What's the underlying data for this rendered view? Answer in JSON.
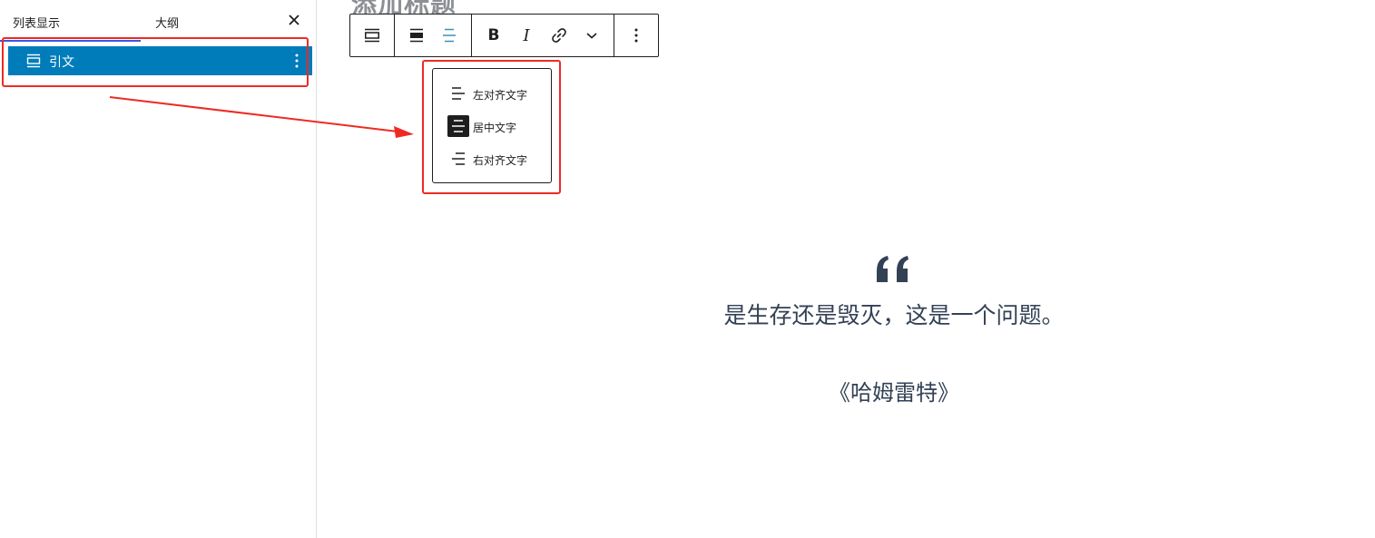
{
  "sidebar": {
    "tabs": [
      {
        "label": "列表显示",
        "active": true
      },
      {
        "label": "大纲",
        "active": false
      }
    ],
    "close_icon": "close-icon",
    "list_items": [
      {
        "label": "引文",
        "icon": "quote-block-icon",
        "selected": true
      }
    ]
  },
  "editor": {
    "title_peek": "添加标题",
    "toolbar": {
      "buttons": [
        "quote-block-icon",
        "align-icon",
        "align-center-icon",
        "bold",
        "italic",
        "link-icon",
        "chevron-down-icon",
        "more-vertical-icon"
      ],
      "bold_label": "B",
      "italic_label": "I"
    },
    "align_menu": {
      "items": [
        {
          "label": "左对齐文字",
          "icon": "align-left-icon",
          "active": false
        },
        {
          "label": "居中文字",
          "icon": "align-center-icon",
          "active": true
        },
        {
          "label": "右对齐文字",
          "icon": "align-right-icon",
          "active": false
        }
      ]
    },
    "quote": {
      "text": "是生存还是毁灭，这是一个问题。",
      "citation": "《哈姆雷特》"
    }
  },
  "colors": {
    "selection": "#007cba",
    "annotation": "#ee2a24",
    "toolbar_border": "#1e1e1e",
    "quote_text": "#334155"
  }
}
